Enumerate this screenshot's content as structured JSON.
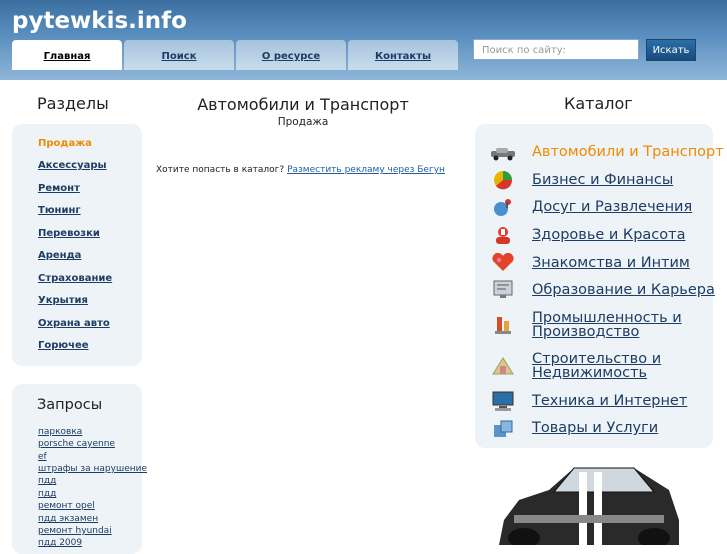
{
  "header": {
    "logo": "pytewkis.info",
    "tabs": [
      {
        "label": "Главная"
      },
      {
        "label": "Поиск"
      },
      {
        "label": "О ресурсе"
      },
      {
        "label": "Контакты"
      }
    ],
    "search_placeholder": "Поиск по сайту:",
    "search_button": "Искать"
  },
  "sections": {
    "title": "Разделы",
    "items": [
      "Продажа",
      "Аксессуары",
      "Ремонт",
      "Тюнинг",
      "Перевозки",
      "Аренда",
      "Страхование",
      "Укрытия",
      "Охрана авто",
      "Горючее"
    ]
  },
  "queries": {
    "title": "Запросы",
    "items": [
      "парковка",
      "porsche cayenne",
      "ef",
      "штрафы за нарушение",
      "пдд",
      "пдд",
      "ремонт opel",
      "пдд экзамен",
      "ремонт hyundai",
      "пдд 2009"
    ]
  },
  "main": {
    "title": "Автомобили и Транспорт",
    "subtitle": "Продажа",
    "promo_text": "Хотите попасть в каталог?",
    "promo_link": "Разместить рекламу через Бегун"
  },
  "catalog": {
    "title": "Каталог",
    "items": [
      {
        "label": "Автомобили и Транспорт",
        "icon": "car-icon"
      },
      {
        "label": "Бизнес и Финансы",
        "icon": "pie-chart-icon"
      },
      {
        "label": "Досуг и Развлечения",
        "icon": "leisure-icon"
      },
      {
        "label": "Здоровье и Красота",
        "icon": "health-icon"
      },
      {
        "label": "Знакомства и Интим",
        "icon": "heart-icon"
      },
      {
        "label": "Образование и Карьера",
        "icon": "education-icon"
      },
      {
        "label": "Промышленность и Производство",
        "icon": "industry-icon"
      },
      {
        "label": "Строительство и Недвижимость",
        "icon": "construction-icon"
      },
      {
        "label": "Техника и Интернет",
        "icon": "computer-icon"
      },
      {
        "label": "Товары и Услуги",
        "icon": "goods-icon"
      }
    ]
  },
  "colors": {
    "header_blue": "#3b6fa0",
    "link_blue": "#1d3d63",
    "active_orange": "#f08a00",
    "panel_bg": "#eef3f8"
  }
}
